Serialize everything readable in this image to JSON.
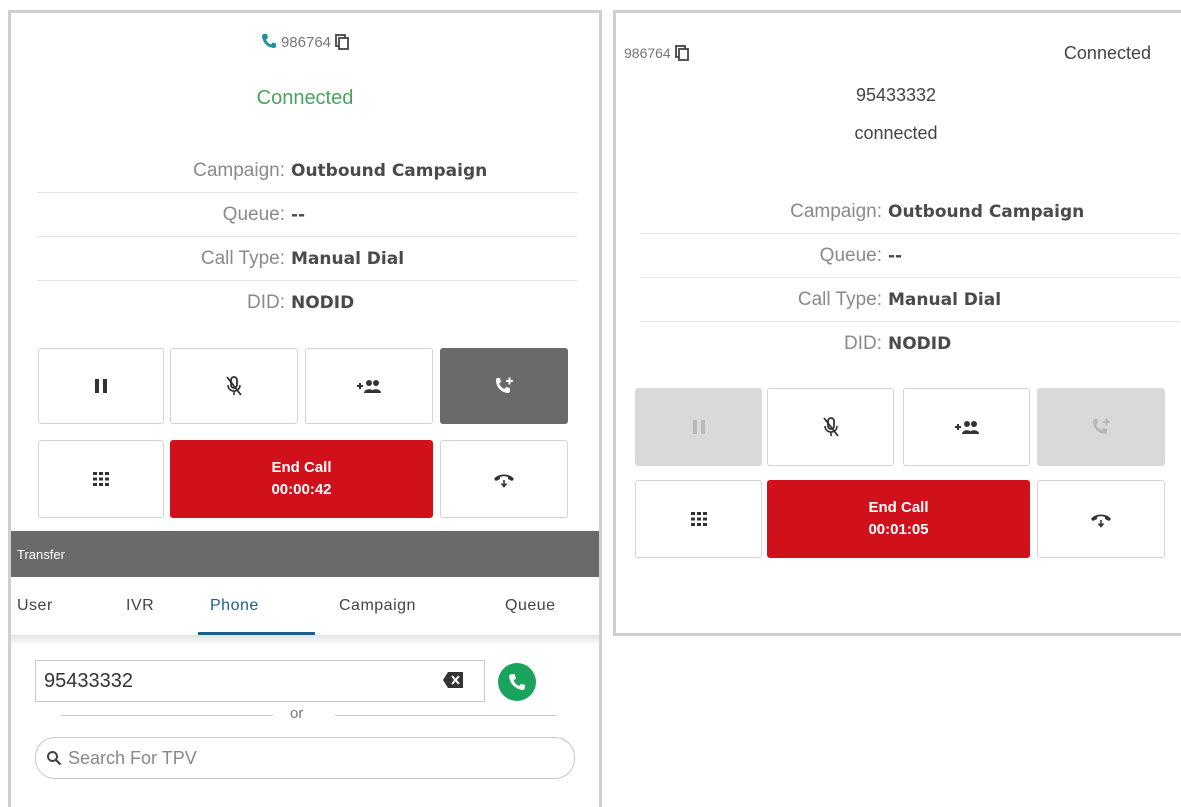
{
  "left": {
    "number": "986764",
    "status": "Connected",
    "info": [
      {
        "label": "Campaign:",
        "value": "Outbound Campaign"
      },
      {
        "label": "Queue:",
        "value": "--"
      },
      {
        "label": "Call Type:",
        "value": "Manual Dial"
      },
      {
        "label": "DID:",
        "value": "NODID"
      }
    ],
    "end_call_label": "End Call",
    "timer": "00:00:42",
    "transfer": {
      "title": "Transfer",
      "tabs": [
        "User",
        "IVR",
        "Phone",
        "Campaign",
        "Queue"
      ],
      "active_tab": "Phone",
      "phone_value": "95433332",
      "or_text": "or",
      "search_placeholder": "Search For TPV"
    }
  },
  "right": {
    "number": "986764",
    "status": "Connected",
    "transfer_number": "95433332",
    "transfer_status": "connected",
    "info": [
      {
        "label": "Campaign:",
        "value": "Outbound Campaign"
      },
      {
        "label": "Queue:",
        "value": "--"
      },
      {
        "label": "Call Type:",
        "value": "Manual Dial"
      },
      {
        "label": "DID:",
        "value": "NODID"
      }
    ],
    "end_call_label": "End Call",
    "timer": "00:01:05"
  },
  "colors": {
    "end_call": "#d0101a",
    "accent": "#1f5f8b",
    "connected_green": "#49a55c",
    "dial_green": "#1aa35a"
  },
  "icons": [
    "phone-icon",
    "copy-icon",
    "pause-icon",
    "mute-icon",
    "add-participant-icon",
    "transfer-call-icon",
    "dialpad-icon",
    "hangup-icon",
    "backspace-icon",
    "search-icon"
  ]
}
